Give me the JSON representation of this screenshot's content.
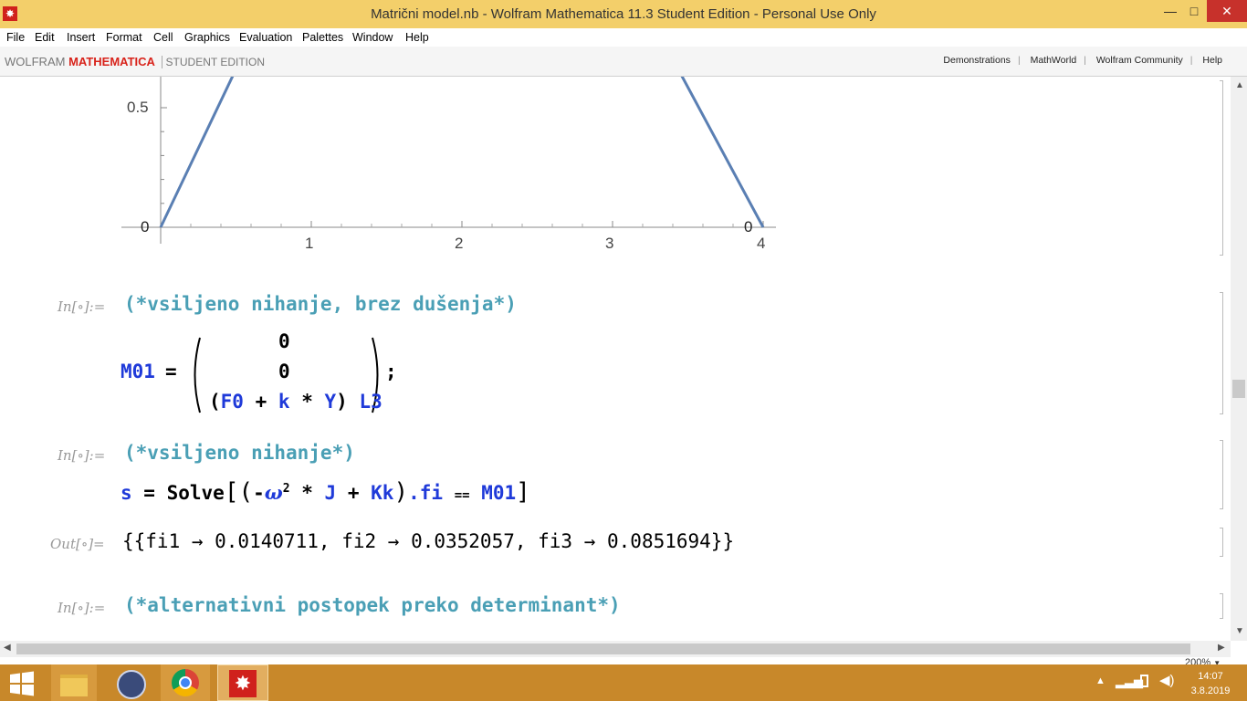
{
  "window": {
    "title": "Matrični model.nb - Wolfram Mathematica 11.3 Student Edition - Personal Use Only",
    "minimize": "—",
    "restore": "□",
    "close": "✕"
  },
  "menu": [
    "File",
    "Edit",
    "Insert",
    "Format",
    "Cell",
    "Graphics",
    "Evaluation",
    "Palettes",
    "Window",
    "Help"
  ],
  "brand": {
    "wolfram": "WOLFRAM",
    "mathematica": "MATHEMATICA",
    "edition": "STUDENT EDITION"
  },
  "links": [
    "Demonstrations",
    "MathWorld",
    "Wolfram Community",
    "Help"
  ],
  "plot": {
    "y_ticks": [
      "0.5",
      "0"
    ],
    "x_ticks": [
      "1",
      "2",
      "3",
      "4"
    ],
    "end_label": "0",
    "line_color": "#5a7fb3",
    "chart_data": {
      "type": "line",
      "x": [
        0,
        0.62,
        3.3,
        4
      ],
      "y": [
        0,
        0.82,
        0.82,
        0
      ],
      "xlim": [
        0,
        4
      ],
      "ylim": [
        0,
        0.62
      ]
    }
  },
  "cells": {
    "in_label": "In[∘]:=",
    "out_label": "Out[∘]=",
    "c1_comment": "(*vsiljeno nihanje, brez dušenja*)",
    "c1_lhs": "M01",
    "c1_eq": "=",
    "c1_r1": "0",
    "c1_r2": "0",
    "c1_r3_open": "(",
    "c1_r3_f0": "F0",
    "c1_r3_plus": " + ",
    "c1_r3_k": "k",
    "c1_r3_star": " * ",
    "c1_r3_y": "Y",
    "c1_r3_close": ")",
    "c1_r3_l3": "L3",
    "c1_semi": ";",
    "c2_comment": "(*vsiljeno nihanje*)",
    "c2_s": "s",
    "c2_eq": " = ",
    "c2_solve": "Solve",
    "c2_omega": "ω",
    "c2_exp": "2",
    "c2_j": "J",
    "c2_kk": "Kk",
    "c2_fi": ".fi",
    "c2_eqeq": "==",
    "c2_m01": "M01",
    "out_value": "{{fi1 → 0.0140711, fi2 → 0.0352057, fi3 → 0.0851694}}",
    "c3_comment": "(*alternativni postopek preko determinant*)"
  },
  "status": {
    "zoom": "200%"
  },
  "taskbar": {
    "time": "14:07",
    "date": "3.8.2019"
  }
}
